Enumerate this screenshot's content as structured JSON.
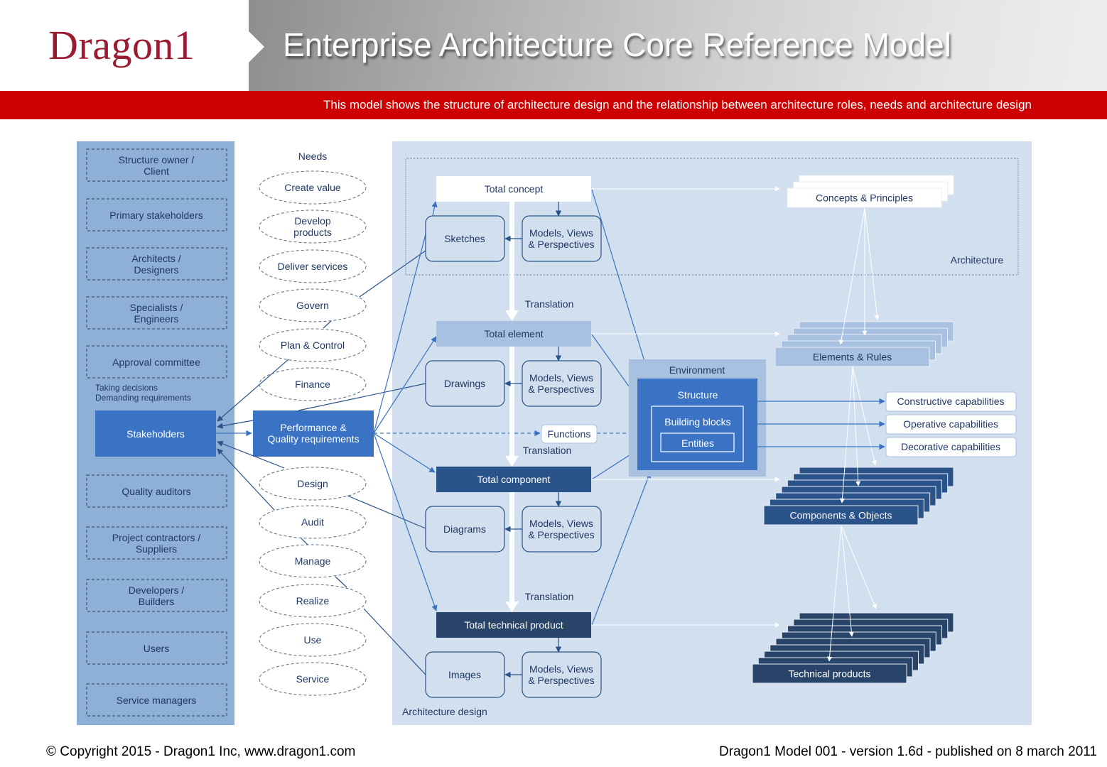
{
  "header": {
    "logo": "Dragon1",
    "title": "Enterprise Architecture Core Reference Model",
    "subtitle": "This model shows the structure of architecture design and the relationship between architecture roles, needs and architecture design"
  },
  "colors": {
    "brand_red": "#cc0000",
    "logo_red": "#9b1b30",
    "roles_panel": "#8eafd6",
    "design_panel": "#d2dfee",
    "stakeholder_blue": "#3a73c4",
    "element_blue": "#a9c1e0",
    "component_blue": "#2a5389",
    "product_blue": "#284468",
    "text_dark": "#1f3864",
    "line_blue": "#3a73c4"
  },
  "roles": {
    "items": [
      "Structure owner /\nClient",
      "Primary stakeholders",
      "Architects /\nDesigners",
      "Specialists /\nEngineers",
      "Approval committee",
      "Quality auditors",
      "Project contractors /\nSuppliers",
      "Developers /\nBuilders",
      "Users",
      "Service managers"
    ],
    "note_line1": "Taking decisions",
    "note_line2": "Demanding requirements",
    "stakeholders": "Stakeholders"
  },
  "needs": {
    "title": "Needs",
    "items": [
      "Create value",
      "Develop\nproducts",
      "Deliver services",
      "Govern",
      "Plan & Control",
      "Finance",
      "Design",
      "Audit",
      "Manage",
      "Realize",
      "Use",
      "Service"
    ]
  },
  "requirements": "Performance &\nQuality requirements",
  "design": {
    "panel_label": "Architecture design",
    "architecture_label": "Architecture",
    "translation_label": "Translation",
    "levels": [
      {
        "name": "Total concept",
        "work": "Sketches",
        "models": "Models, Views\n& Perspectives"
      },
      {
        "name": "Total element",
        "work": "Drawings",
        "models": "Models, Views\n& Perspectives"
      },
      {
        "name": "Total component",
        "work": "Diagrams",
        "models": "Models, Views\n& Perspectives"
      },
      {
        "name": "Total technical product",
        "work": "Images",
        "models": "Models, Views\n& Perspectives"
      }
    ],
    "functions": "Functions",
    "environment": {
      "label": "Environment",
      "structure": "Structure",
      "building_blocks": "Building blocks",
      "entities": "Entities"
    },
    "capabilities": [
      "Constructive capabilities",
      "Operative capabilities",
      "Decorative capabilities"
    ],
    "stacks": [
      {
        "label": "Concepts & Principles",
        "layers": 3
      },
      {
        "label": "Elements & Rules",
        "layers": 5
      },
      {
        "label": "Components & Objects",
        "layers": 7
      },
      {
        "label": "Technical products",
        "layers": 9
      }
    ]
  },
  "footer": {
    "copyright": "© Copyright 2015 - Dragon1 Inc, www.dragon1.com",
    "version": "Dragon1 Model 001 - version 1.6d - published  on 8 march 2011"
  }
}
